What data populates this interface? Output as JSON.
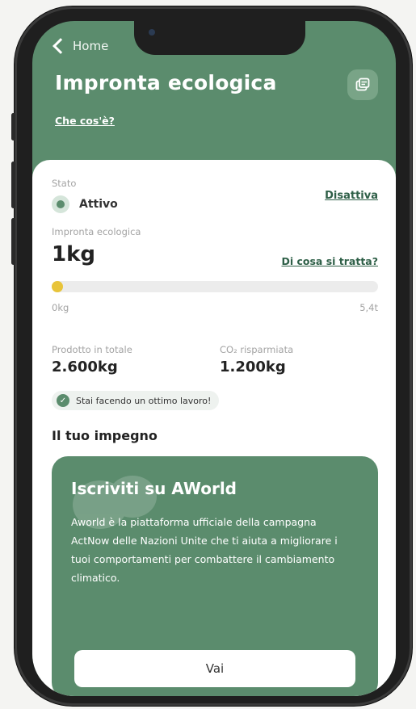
{
  "header": {
    "back_label": "Home",
    "title": "Impronta ecologica",
    "what_link": "Che cos'è?"
  },
  "status": {
    "label": "Stato",
    "value": "Attivo",
    "toggle_link": "Disattiva"
  },
  "footprint": {
    "label": "Impronta ecologica",
    "value": "1kg",
    "info_link": "Di cosa si tratta?",
    "bar_min": "0kg",
    "bar_max": "5,4t",
    "progress_fraction": 0.03
  },
  "stats": [
    {
      "label": "Prodotto in totale",
      "value": "2.600kg"
    },
    {
      "label": "CO₂ risparmiata",
      "value": "1.200kg"
    }
  ],
  "feedback": "Stai facendo un ottimo lavoro!",
  "commitment": {
    "section_title": "Il tuo impegno",
    "promo_title": "Iscriviti su AWorld",
    "promo_body": "Aworld è la piattaforma ufficiale della campagna ActNow delle Nazioni Unite che ti aiuta a migliorare i tuoi comportamenti per combattere il cambiamento climatico.",
    "cta_label": "Vai"
  },
  "colors": {
    "brand_green": "#5b8c6d",
    "progress_yellow": "#e8c43a"
  },
  "icons": {
    "back": "chevron-left-icon",
    "share": "share-card-icon",
    "state": "status-dot-icon",
    "feedback": "check-circle-icon"
  }
}
